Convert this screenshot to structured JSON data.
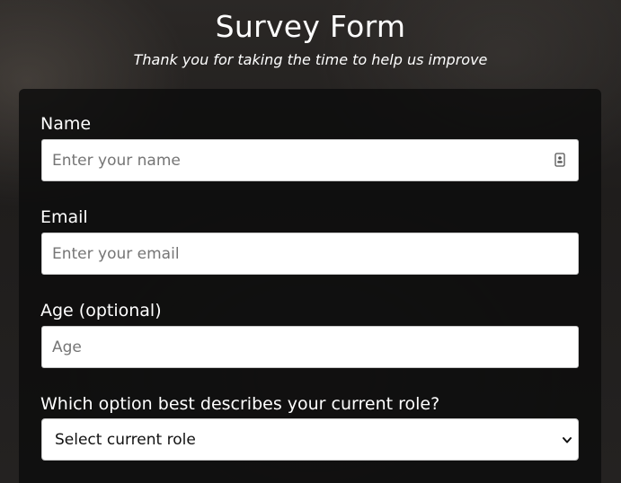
{
  "header": {
    "title": "Survey Form",
    "subtitle": "Thank you for taking the time to help us improve"
  },
  "form": {
    "name": {
      "label": "Name",
      "placeholder": "Enter your name",
      "value": ""
    },
    "email": {
      "label": "Email",
      "placeholder": "Enter your email",
      "value": ""
    },
    "age": {
      "label": "Age (optional)",
      "placeholder": "Age",
      "value": ""
    },
    "role": {
      "label": "Which option best describes your current role?",
      "selected": "Select current role"
    }
  },
  "icons": {
    "name_field_icon": "contact-card-icon",
    "role_dropdown_icon": "chevron-down-icon"
  },
  "colors": {
    "text_on_dark": "#ffffff",
    "input_background": "#ffffff",
    "placeholder": "#757575"
  }
}
